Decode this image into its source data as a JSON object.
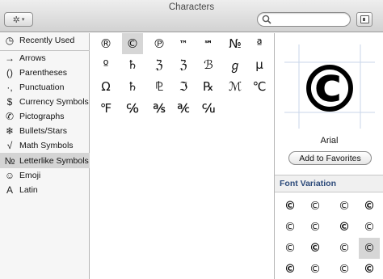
{
  "window": {
    "title": "Characters"
  },
  "toolbar": {
    "gear_icon": "✲",
    "gear_caret": "▾",
    "search_value": "",
    "search_placeholder": ""
  },
  "sidebar": {
    "items": [
      {
        "icon": "◷",
        "icon_name": "clock-icon",
        "label": "Recently Used"
      },
      {
        "icon": "→",
        "icon_name": "arrow-icon",
        "label": "Arrows"
      },
      {
        "icon": "()",
        "icon_name": "parentheses-icon",
        "label": "Parentheses"
      },
      {
        "icon": "·,",
        "icon_name": "punctuation-icon",
        "label": "Punctuation"
      },
      {
        "icon": "$",
        "icon_name": "dollar-icon",
        "label": "Currency Symbols"
      },
      {
        "icon": "✆",
        "icon_name": "phone-icon",
        "label": "Pictographs"
      },
      {
        "icon": "❄",
        "icon_name": "snowflake-icon",
        "label": "Bullets/Stars"
      },
      {
        "icon": "√",
        "icon_name": "root-icon",
        "label": "Math Symbols"
      },
      {
        "icon": "№",
        "icon_name": "numero-icon",
        "label": "Letterlike Symbols"
      },
      {
        "icon": "☺",
        "icon_name": "smiley-icon",
        "label": "Emoji"
      },
      {
        "icon": "A",
        "icon_name": "letter-a-icon",
        "label": "Latin"
      }
    ],
    "selected_index": 8
  },
  "grid": {
    "rows": [
      [
        "®",
        "©",
        "℗",
        "™",
        "℠",
        "№",
        "ª"
      ],
      [
        "º",
        "♄",
        "ℨ",
        "ℨ",
        "ℬ",
        "ℊ",
        "µ"
      ],
      [
        "Ω",
        "♄",
        "⅊",
        "ℑ",
        "℞",
        "ℳ",
        "℃"
      ],
      [
        "℉",
        "℅",
        "℁",
        "℀",
        "℆"
      ]
    ],
    "selected": [
      0,
      1
    ]
  },
  "preview": {
    "glyph": "©",
    "font_name": "Arial",
    "add_favorites_label": "Add to Favorites"
  },
  "font_variation": {
    "header": "Font Variation",
    "rows": [
      [
        "©",
        "©",
        "©",
        "©"
      ],
      [
        "©",
        "©",
        "©",
        "©"
      ],
      [
        "©",
        "©",
        "©",
        "©"
      ],
      [
        "©",
        "©",
        "©",
        "©"
      ]
    ],
    "selected": [
      2,
      3
    ]
  }
}
